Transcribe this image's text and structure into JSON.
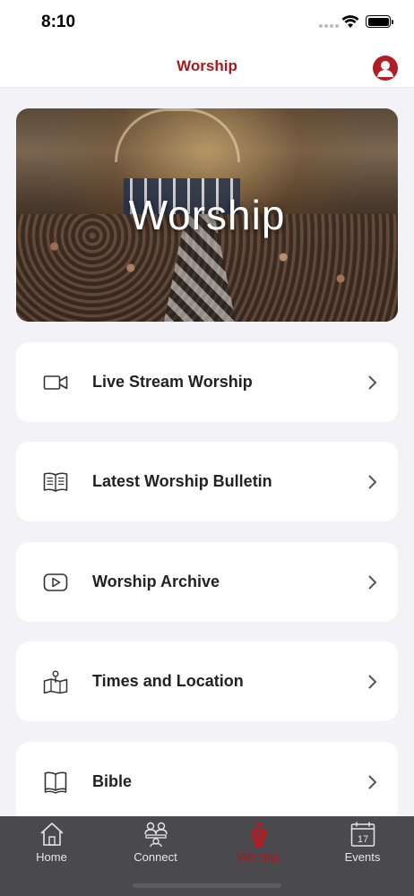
{
  "status_bar": {
    "time": "8:10"
  },
  "nav": {
    "title": "Worship",
    "profile_icon": "person-circle-icon"
  },
  "hero": {
    "title": "Worship"
  },
  "menu": [
    {
      "label": "Live Stream Worship",
      "icon": "video-camera-icon"
    },
    {
      "label": "Latest Worship Bulletin",
      "icon": "open-book-icon"
    },
    {
      "label": "Worship Archive",
      "icon": "play-video-icon"
    },
    {
      "label": "Times and Location",
      "icon": "map-pin-icon"
    },
    {
      "label": "Bible",
      "icon": "bible-book-icon"
    }
  ],
  "tabs": [
    {
      "label": "Home",
      "icon": "house-icon",
      "active": false
    },
    {
      "label": "Connect",
      "icon": "people-icon",
      "active": false
    },
    {
      "label": "Worship",
      "icon": "pastor-icon",
      "active": true
    },
    {
      "label": "Events",
      "icon": "calendar-icon",
      "active": false,
      "calendar_day": "17"
    }
  ],
  "colors": {
    "accent": "#a51a1f",
    "background": "#f2f2f7",
    "tab_bar": "#4a4a4e"
  }
}
